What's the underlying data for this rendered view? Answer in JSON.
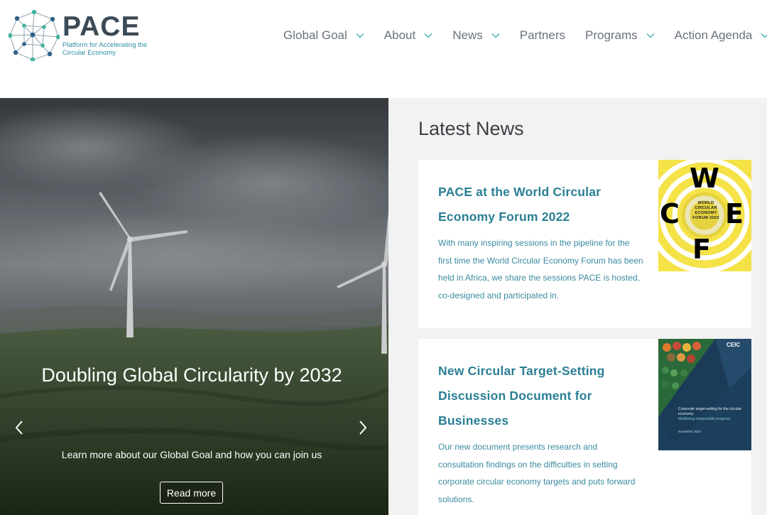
{
  "brand": {
    "name": "PACE",
    "subtitle": "Platform for Accelerating the Circular Economy",
    "colors": {
      "primary": "#3a4a56",
      "accent": "#2f8fa0",
      "teal_dot": "#3fb39d",
      "navy_dot": "#2d5f86"
    }
  },
  "nav": {
    "items": [
      {
        "label": "Global Goal",
        "dropdown": true
      },
      {
        "label": "About",
        "dropdown": true
      },
      {
        "label": "News",
        "dropdown": true
      },
      {
        "label": "Partners",
        "dropdown": false
      },
      {
        "label": "Programs",
        "dropdown": true
      },
      {
        "label": "Action Agenda",
        "dropdown": true
      }
    ]
  },
  "hero": {
    "title": "Doubling Global Circularity by 2032",
    "description": "Learn more about our Global Goal and how you can join us",
    "button_label": "Read more",
    "prev_icon": "chevron-left-icon",
    "next_icon": "chevron-right-icon"
  },
  "news": {
    "heading": "Latest News",
    "articles": [
      {
        "title": "PACE at the World Circular Economy Forum 2022",
        "summary": "With many inspiring sessions in the pipeline for the first time the World Circular Economy Forum has been held in Africa, we share the sessions PACE is hosted, co-designed and participated in.",
        "thumbnail": {
          "letters": [
            "W",
            "C",
            "E",
            "F"
          ],
          "caption": "WORLD CIRCULAR ECONOMY FORUM 2022"
        }
      },
      {
        "title": "New Circular Target-Setting Discussion Document for Businesses",
        "summary": "Our new document presents research and consultation findings on the difficulties in setting corporate circular economy targets and puts forward solutions.",
        "thumbnail": {
          "logo": "CEIC",
          "heading": "Corporate target-setting for the circular economy:",
          "subheading": "Mobilizing measurable progress",
          "date": "November 2022"
        }
      }
    ]
  }
}
